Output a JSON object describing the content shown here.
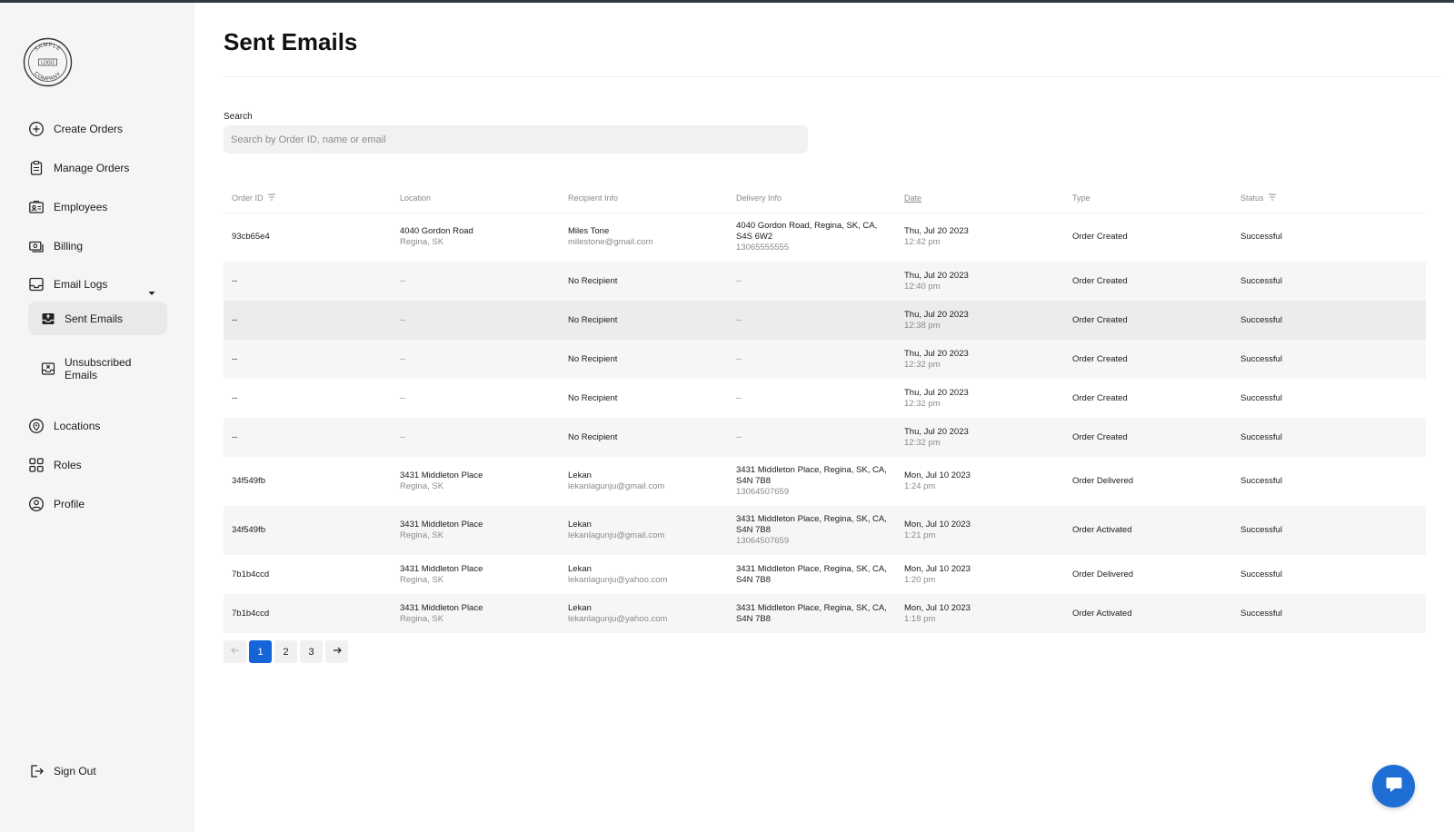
{
  "sidebar": {
    "logo_lines": [
      "SAMPLE",
      "LOGO",
      "COMPANY"
    ],
    "items": [
      {
        "label": "Create Orders",
        "icon": "plus-circle-icon"
      },
      {
        "label": "Manage Orders",
        "icon": "clipboard-icon"
      },
      {
        "label": "Employees",
        "icon": "id-card-icon"
      },
      {
        "label": "Billing",
        "icon": "money-icon"
      },
      {
        "label": "Email Logs",
        "icon": "inbox-icon"
      },
      {
        "label": "Locations",
        "icon": "location-pin-icon"
      },
      {
        "label": "Roles",
        "icon": "grid-icon"
      },
      {
        "label": "Profile",
        "icon": "user-circle-icon"
      }
    ],
    "sub_items": [
      {
        "label": "Sent Emails",
        "icon": "outbox-icon",
        "active": true
      },
      {
        "label": "Unsubscribed Emails",
        "label_line1": "Unsubscribed",
        "label_line2": "Emails",
        "icon": "inbox-x-icon"
      }
    ],
    "sign_out": "Sign Out"
  },
  "page": {
    "title": "Sent Emails",
    "search_label": "Search",
    "search_placeholder": "Search by Order ID, name or email",
    "search_value": ""
  },
  "table": {
    "headers": [
      "Order ID",
      "Location",
      "Recipient Info",
      "Delivery Info",
      "Date",
      "Type",
      "Status"
    ],
    "rows": [
      {
        "order_id": "93cb65e4",
        "loc1": "4040 Gordon Road",
        "loc2": "Regina, SK",
        "rec1": "Miles Tone",
        "rec2": "milestone@gmail.com",
        "del1": "4040 Gordon Road, Regina, SK, CA,",
        "del2": "S4S 6W2",
        "del3": "13065555555",
        "date1": "Thu, Jul 20 2023",
        "date2": "12:42 pm",
        "type": "Order Created",
        "status": "Successful"
      },
      {
        "order_id": "--",
        "loc1": "--",
        "loc2": "",
        "rec1": "No Recipient",
        "rec2": "",
        "del1": "--",
        "del2": "",
        "del3": "",
        "date1": "Thu, Jul 20 2023",
        "date2": "12:40 pm",
        "type": "Order Created",
        "status": "Successful"
      },
      {
        "order_id": "--",
        "loc1": "--",
        "loc2": "",
        "rec1": "No Recipient",
        "rec2": "",
        "del1": "--",
        "del2": "",
        "del3": "",
        "date1": "Thu, Jul 20 2023",
        "date2": "12:38 pm",
        "type": "Order Created",
        "status": "Successful"
      },
      {
        "order_id": "--",
        "loc1": "--",
        "loc2": "",
        "rec1": "No Recipient",
        "rec2": "",
        "del1": "--",
        "del2": "",
        "del3": "",
        "date1": "Thu, Jul 20 2023",
        "date2": "12:32 pm",
        "type": "Order Created",
        "status": "Successful"
      },
      {
        "order_id": "--",
        "loc1": "--",
        "loc2": "",
        "rec1": "No Recipient",
        "rec2": "",
        "del1": "--",
        "del2": "",
        "del3": "",
        "date1": "Thu, Jul 20 2023",
        "date2": "12:32 pm",
        "type": "Order Created",
        "status": "Successful"
      },
      {
        "order_id": "--",
        "loc1": "--",
        "loc2": "",
        "rec1": "No Recipient",
        "rec2": "",
        "del1": "--",
        "del2": "",
        "del3": "",
        "date1": "Thu, Jul 20 2023",
        "date2": "12:32 pm",
        "type": "Order Created",
        "status": "Successful"
      },
      {
        "order_id": "34f549fb",
        "loc1": "3431 Middleton Place",
        "loc2": "Regina, SK",
        "rec1": "Lekan",
        "rec2": "lekanlagunju@gmail.com",
        "del1": "3431 Middleton Place, Regina, SK, CA,",
        "del2": "S4N 7B8",
        "del3": "13064507659",
        "date1": "Mon, Jul 10 2023",
        "date2": "1:24 pm",
        "type": "Order Delivered",
        "status": "Successful"
      },
      {
        "order_id": "34f549fb",
        "loc1": "3431 Middleton Place",
        "loc2": "Regina, SK",
        "rec1": "Lekan",
        "rec2": "lekanlagunju@gmail.com",
        "del1": "3431 Middleton Place, Regina, SK, CA,",
        "del2": "S4N 7B8",
        "del3": "13064507659",
        "date1": "Mon, Jul 10 2023",
        "date2": "1:21 pm",
        "type": "Order Activated",
        "status": "Successful"
      },
      {
        "order_id": "7b1b4ccd",
        "loc1": "3431 Middleton Place",
        "loc2": "Regina, SK",
        "rec1": "Lekan",
        "rec2": "lekanlagunju@yahoo.com",
        "del1": "3431 Middleton Place, Regina, SK, CA,",
        "del2": "S4N 7B8",
        "del3": "",
        "date1": "Mon, Jul 10 2023",
        "date2": "1:20 pm",
        "type": "Order Delivered",
        "status": "Successful"
      },
      {
        "order_id": "7b1b4ccd",
        "loc1": "3431 Middleton Place",
        "loc2": "Regina, SK",
        "rec1": "Lekan",
        "rec2": "lekanlagunju@yahoo.com",
        "del1": "3431 Middleton Place, Regina, SK, CA,",
        "del2": "S4N 7B8",
        "del3": "",
        "date1": "Mon, Jul 10 2023",
        "date2": "1:18 pm",
        "type": "Order Activated",
        "status": "Successful"
      }
    ]
  },
  "pagination": {
    "pages": [
      "1",
      "2",
      "3"
    ],
    "current": "1",
    "prev_icon": "arrow-left-icon",
    "next_icon": "arrow-right-icon"
  },
  "colors": {
    "accent": "#1565d8",
    "chat_button": "#1f6ed4",
    "sidebar_bg": "#f5f5f5"
  }
}
